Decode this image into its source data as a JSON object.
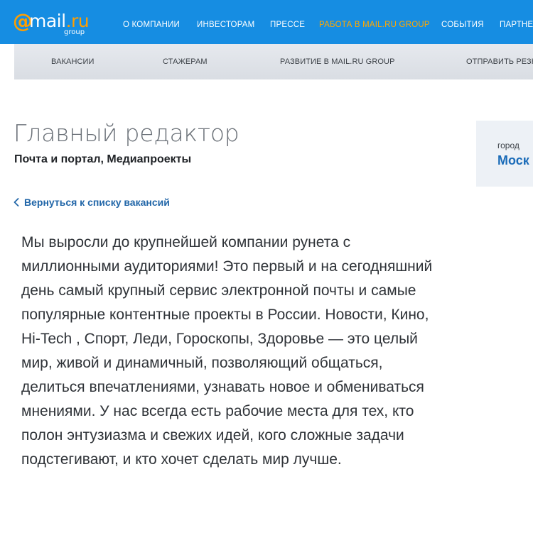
{
  "header": {
    "logo": {
      "at": "@",
      "word": "mail",
      "tld": ".ru",
      "group": "group"
    },
    "nav": [
      {
        "label": "О КОМПАНИИ",
        "active": false
      },
      {
        "label": "ИНВЕСТОРАМ",
        "active": false
      },
      {
        "label": "ПРЕССЕ",
        "active": false
      },
      {
        "label": "РАБОТА В MAIL.RU GROUP",
        "active": true
      },
      {
        "label": "СОБЫТИЯ",
        "active": false
      },
      {
        "label": "ПАРТНЕР",
        "active": false
      }
    ],
    "colors": {
      "bar": "#168de2",
      "accent": "#ffa800"
    }
  },
  "subnav": [
    {
      "label": "ВАКАНСИИ"
    },
    {
      "label": "СТАЖЕРАМ"
    },
    {
      "label": "РАЗВИТИЕ В MAIL.RU GROUP"
    },
    {
      "label": "ОТПРАВИТЬ РЕЗЮ"
    }
  ],
  "job": {
    "title": "Главный редактор",
    "department": "Почта и портал, Медиапроекты"
  },
  "city": {
    "label": "город",
    "value": "Моск"
  },
  "back_link": {
    "icon": "chevron-left-icon",
    "label": "Вернуться к списку вакансий"
  },
  "description": "Мы выросли до крупнейшей компании рунета с миллионными аудиториями! Это первый и на сегодняшний день самый крупный сервис электронной почты и самые популярные контентные проекты в России. Новости, Кино, Hi-Tech , Спорт, Леди, Гороскопы, Здоровье — это целый мир, живой и динамичный, позволяющий общаться, делиться впечатлениями, узнавать новое и обмениваться мнениями. У нас всегда есть рабочие места для тех, кто полон энтузиазма и свежих идей, кого сложные задачи подстегивают, и кто хочет сделать мир лучше."
}
